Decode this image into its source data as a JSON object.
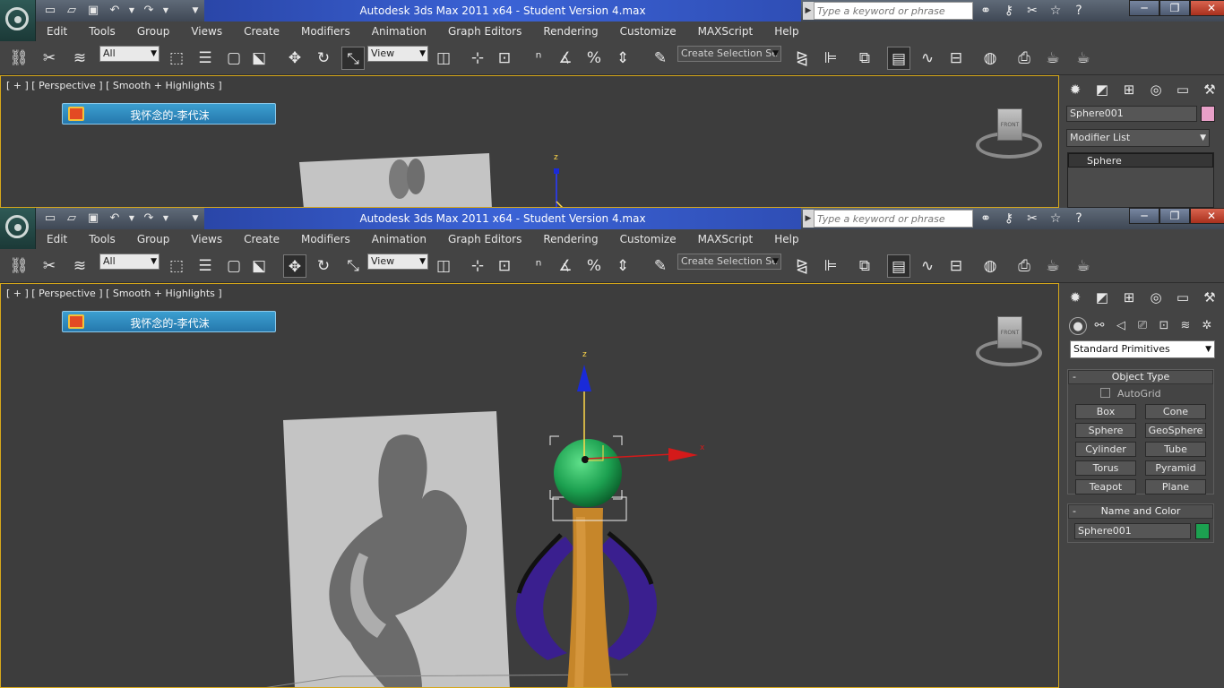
{
  "app": {
    "title": "Autodesk 3ds Max  2011 x64  - Student Version    4.max",
    "search_placeholder": "Type a keyword or phrase"
  },
  "menu": [
    "Edit",
    "Tools",
    "Group",
    "Views",
    "Create",
    "Modifiers",
    "Animation",
    "Graph Editors",
    "Rendering",
    "Customize",
    "MAXScript",
    "Help"
  ],
  "toolbar": {
    "filter_value": "All",
    "ref_coord_value": "View",
    "named_selection_placeholder": "Create Selection Se"
  },
  "viewport": {
    "label": "[ + ] [ Perspective ] [ Smooth + Highlights ]",
    "banner_text": "我怀念的-李代沫",
    "viewcube_label": "FRONT",
    "axis_z": "z",
    "axis_x": "x"
  },
  "back_panel": {
    "object_name": "Sphere001",
    "modifier_list": "Modifier List",
    "stack_item": "Sphere",
    "color": "#e8a0c8"
  },
  "front_panel": {
    "category_dropdown": "Standard Primitives",
    "object_type": {
      "title": "Object Type",
      "autogrid": "AutoGrid",
      "buttons": [
        "Box",
        "Cone",
        "Sphere",
        "GeoSphere",
        "Cylinder",
        "Tube",
        "Torus",
        "Pyramid",
        "Teapot",
        "Plane"
      ]
    },
    "name_and_color": {
      "title": "Name and Color",
      "object_name": "Sphere001",
      "color": "#1ca050"
    }
  },
  "icons": {
    "app_menu": "3ds-max-logo-icon",
    "quick_access": [
      "new-icon",
      "open-icon",
      "save-icon",
      "undo-icon",
      "redo-icon"
    ],
    "info_center": [
      "binoculars-icon",
      "key-icon",
      "star-icon",
      "help-icon"
    ]
  }
}
